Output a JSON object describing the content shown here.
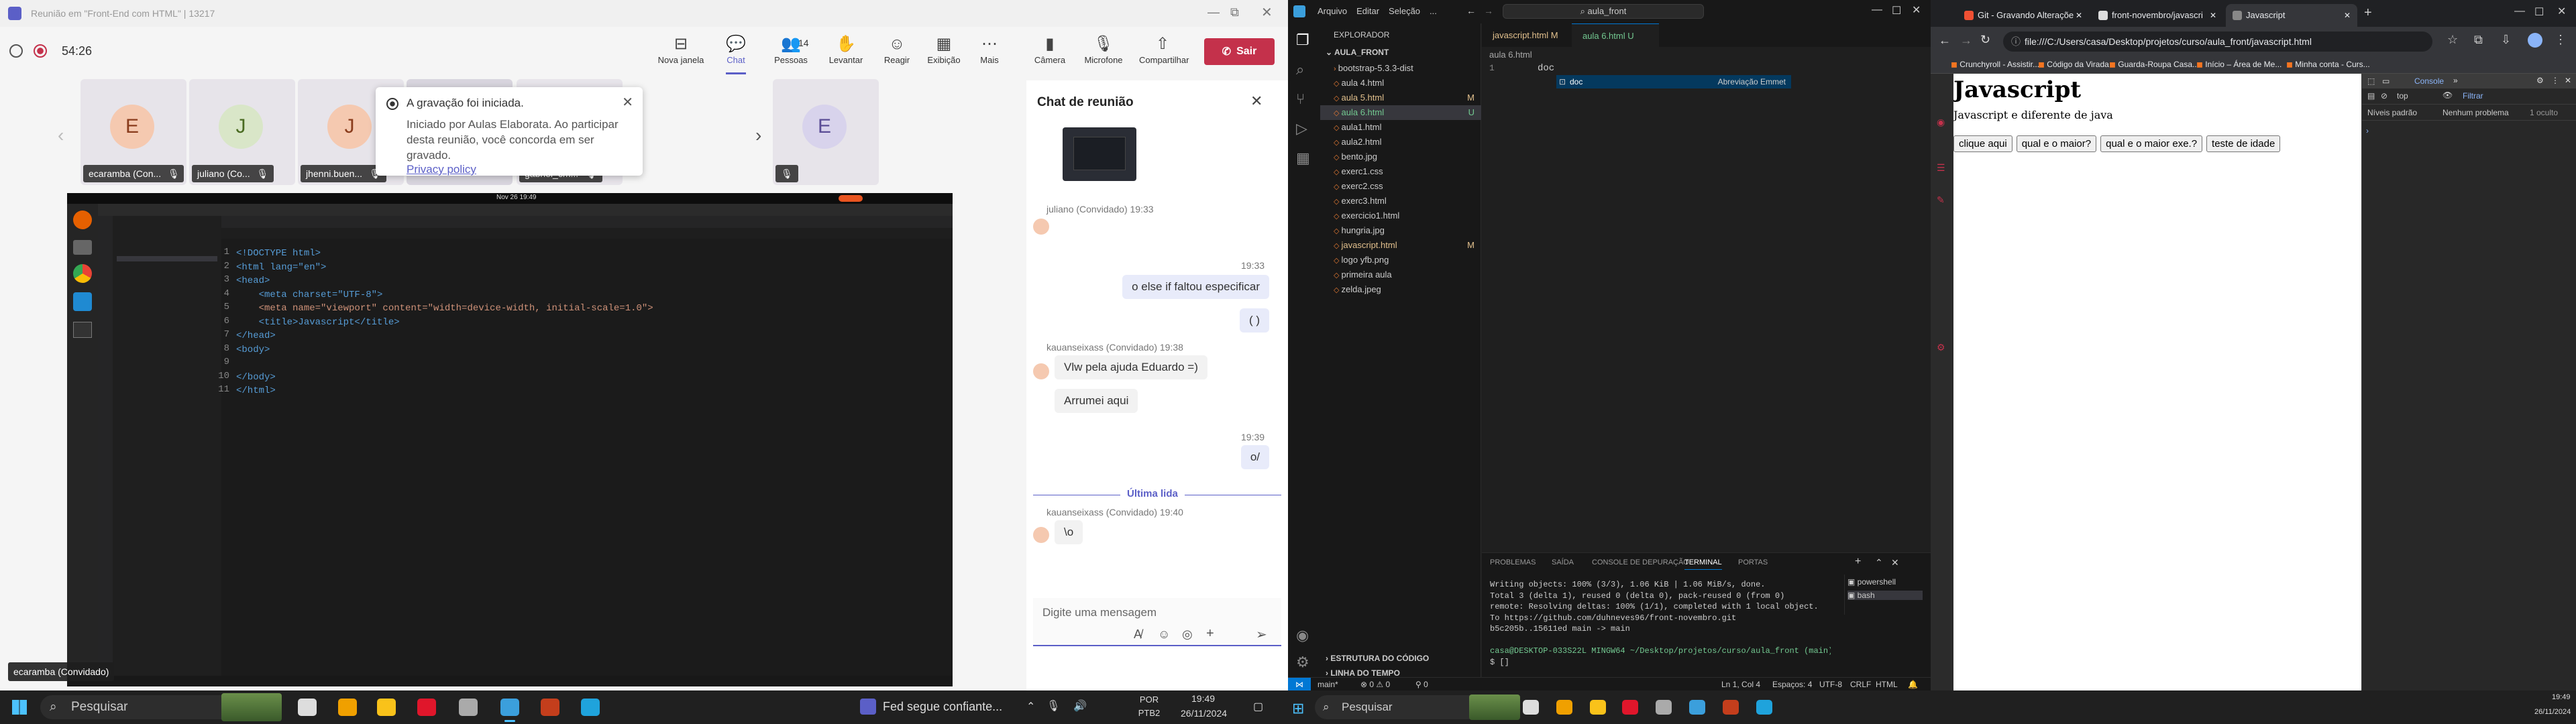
{
  "teams": {
    "title": "Reunião em \"Front-End com HTML\" | 13217",
    "timer": "54:26",
    "toolbar": [
      {
        "label": "Nova janela",
        "icon": "⊟"
      },
      {
        "label": "Chat",
        "icon": "💬"
      },
      {
        "label": "Pessoas",
        "icon": "👥",
        "count": "14"
      },
      {
        "label": "Levantar",
        "icon": "✋"
      },
      {
        "label": "Reagir",
        "icon": "☺"
      },
      {
        "label": "Exibição",
        "icon": "▦"
      },
      {
        "label": "Mais",
        "icon": "⋯"
      },
      {
        "label": "Câmera",
        "icon": "▮"
      },
      {
        "label": "Microfone",
        "icon": "🎙"
      },
      {
        "label": "Compartilhar",
        "icon": "⇧"
      }
    ],
    "leave": "Sair",
    "participants": [
      {
        "initial": "E",
        "name": "ecaramba (Con...",
        "color": "#f5c9b0",
        "fg": "#8a3c1c"
      },
      {
        "initial": "J",
        "name": "juliano (Co...",
        "color": "#d9e6c8",
        "fg": "#4a6b22"
      },
      {
        "initial": "J",
        "name": "jhenni.buen...",
        "color": "#f5c9b0",
        "fg": "#8a3c1c"
      },
      {
        "initial": "G",
        "name": "gabriel_cm...",
        "color": "#f5c9b0",
        "fg": "#8a3c1c"
      },
      {
        "initial": "E",
        "name": "",
        "color": "#d8d3ec",
        "fg": "#5b4d96"
      }
    ],
    "toast": {
      "title": "A gravação foi iniciada.",
      "body": "Iniciado por Aulas Elaborata. Ao participar desta reunião, você concorda em ser gravado.",
      "link": "Privacy policy"
    },
    "presenter_label": "ecaramba (Convidado)",
    "chat": {
      "title": "Chat de reunião",
      "messages": [
        {
          "meta": "juliano (Convidado)  19:33",
          "text": ""
        },
        {
          "time": "19:33",
          "text": "o else if faltou especificar"
        },
        {
          "text": "( )"
        },
        {
          "meta": "kauanseixass (Convidado)  19:38",
          "text": "Vlw pela ajuda Eduardo =)"
        },
        {
          "text": "Arrumei aqui"
        },
        {
          "time": "19:39",
          "text": "o/"
        },
        {
          "divider": "Última lida"
        },
        {
          "meta": "kauanseixass (Convidado)  19:40",
          "text": "\\o"
        }
      ],
      "placeholder": "Digite uma mensagem"
    },
    "shared": {
      "code": [
        "<!DOCTYPE html>",
        "<html lang=\"en\">",
        "<head>",
        "    <meta charset=\"UTF-8\">",
        "    <meta name=\"viewport\" content=\"width=device-width, initial-scale=1.0\">",
        "    <title>Javascript</title>",
        "</head>",
        "<body>",
        "",
        "</body>",
        "</html>"
      ],
      "clock": "Nov 26  19:49"
    }
  },
  "vscode": {
    "menu": [
      "Arquivo",
      "Editar",
      "Seleção",
      "..."
    ],
    "search": "aula_front",
    "explorer_title": "EXPLORADOR",
    "root": "AULA_FRONT",
    "files": [
      {
        "name": "bootstrap-5.3.3-dist",
        "badge": ""
      },
      {
        "name": "aula 4.html",
        "badge": ""
      },
      {
        "name": "aula 5.html",
        "badge": "M"
      },
      {
        "name": "aula 6.html",
        "badge": "U"
      },
      {
        "name": "aula1.html",
        "badge": ""
      },
      {
        "name": "aula2.html",
        "badge": ""
      },
      {
        "name": "bento.jpg",
        "badge": ""
      },
      {
        "name": "exerc1.css",
        "badge": ""
      },
      {
        "name": "exerc2.css",
        "badge": ""
      },
      {
        "name": "exerc3.html",
        "badge": ""
      },
      {
        "name": "exercicio1.html",
        "badge": ""
      },
      {
        "name": "hungria.jpg",
        "badge": ""
      },
      {
        "name": "javascript.html",
        "badge": "M"
      },
      {
        "name": "logo yfb.png",
        "badge": ""
      },
      {
        "name": "primeira aula",
        "badge": ""
      },
      {
        "name": "zelda.jpeg",
        "badge": ""
      }
    ],
    "tabs": [
      "javascript.html M",
      "aula 6.html U"
    ],
    "breadcrumb": "aula 6.html",
    "code_line": "doc",
    "suggest": "doc",
    "suggest_hint": "Abreviação Emmet",
    "outline": "ESTRUTURA DO CÓDIGO",
    "timeline": "LINHA DO TEMPO",
    "panel_tabs": [
      "PROBLEMAS",
      "SAÍDA",
      "CONSOLE DE DEPURAÇÃO",
      "TERMINAL",
      "PORTAS"
    ],
    "terminals": [
      "powershell",
      "bash"
    ],
    "terminal": [
      "Writing objects: 100% (3/3), 1.06 KiB | 1.06 MiB/s, done.",
      "Total 3 (delta 1), reused 0 (delta 0), pack-reused 0 (from 0)",
      "remote: Resolving deltas: 100% (1/1), completed with 1 local object.",
      "To https://github.com/duhneves96/front-novembro.git",
      "   b5c205b..15611ed  main -> main",
      "",
      "casa@DESKTOP-033S22L MINGW64 ~/Desktop/projetos/curso/aula_front (main)",
      "$ []"
    ],
    "status": {
      "branch": "main*",
      "errors": "⊗ 0 ⚠ 0",
      "ports": "⚲ 0",
      "pos": "Ln 1, Col 4",
      "spaces": "Espaços: 4",
      "enc": "UTF-8",
      "eol": "CRLF",
      "lang": "HTML"
    }
  },
  "browser": {
    "tabs": [
      "Git - Gravando Alteraçõe",
      "front-novembro/javascri",
      "Javascript"
    ],
    "url": "file:///C:/Users/casa/Desktop/projetos/curso/aula_front/javascript.html",
    "bookmarks": [
      "Crunchyroll - Assistir...",
      "Código da Virada",
      "Guarda-Roupa Casa...",
      "Início – Área de Me...",
      "Minha conta - Curs..."
    ],
    "page": {
      "h1": "Javascript",
      "p": "Javascript e diferente de java",
      "buttons": [
        "clique aqui",
        "qual e o maior?",
        "qual e o maior exe.?",
        "teste de idade"
      ]
    },
    "devtools": {
      "tab": "Console",
      "context": "top",
      "filter": "Filtrar",
      "levels": "Níveis padrão",
      "issues": "Nenhum problema",
      "hidden": "1 oculto"
    }
  },
  "taskbar": {
    "search": "Pesquisar",
    "weather": "Fed segue confiante...",
    "lang": "POR PTB2",
    "time": "19:49",
    "date": "26/11/2024",
    "search2": "Pesquisar",
    "time2": "19:49",
    "date2": "26/11/2024"
  }
}
